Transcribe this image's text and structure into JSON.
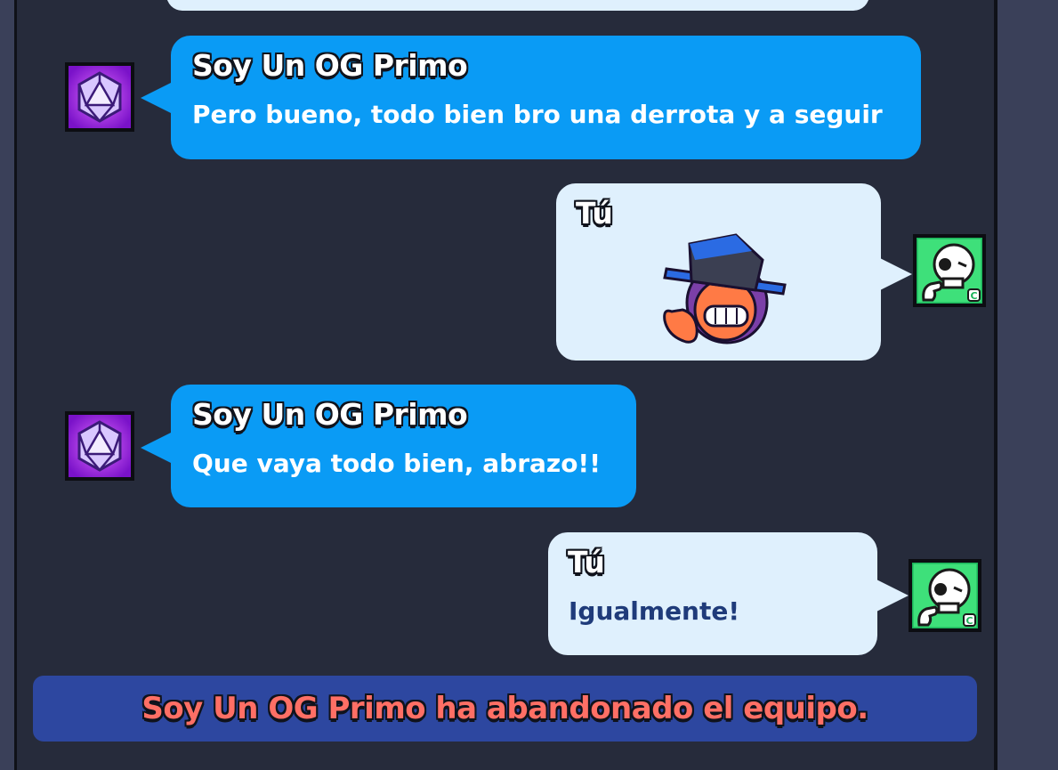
{
  "messages": [
    {
      "sender": "Soy Un OG Primo",
      "text": "Pero bueno, todo bien bro una derrota y a seguir",
      "avatar_icon": "purple-d20-dice-icon"
    },
    {
      "sender": "Tú",
      "sticker_icon": "brawler-pin-sticker-icon",
      "avatar_icon": "green-skull-pin-icon"
    },
    {
      "sender": "Soy Un OG Primo",
      "text": "Que vaya todo bien, abrazo!!",
      "avatar_icon": "purple-d20-dice-icon"
    },
    {
      "sender": "Tú",
      "text": "Igualmente!",
      "avatar_icon": "green-skull-pin-icon"
    }
  ],
  "system_message": "Soy Un OG Primo ha abandonado el equipo.",
  "colors": {
    "background": "#262b3b",
    "other_bubble": "#0a9bf5",
    "my_bubble": "#dff0fd",
    "system_banner": "#2d47a0",
    "system_text": "#ff6f65"
  }
}
